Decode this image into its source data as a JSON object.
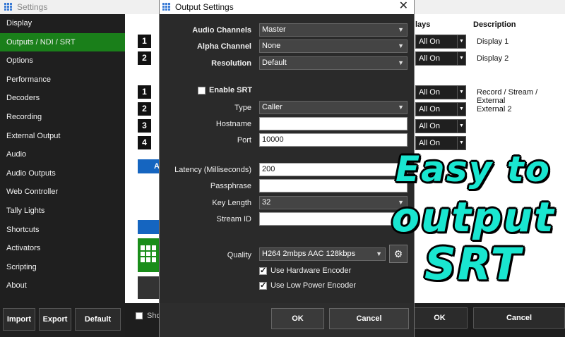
{
  "background_window": {
    "title": "Settings",
    "sidebar": [
      {
        "label": "Display",
        "active": false
      },
      {
        "label": "Outputs / NDI / SRT",
        "active": true
      },
      {
        "label": "Options",
        "active": false
      },
      {
        "label": "Performance",
        "active": false
      },
      {
        "label": "Decoders",
        "active": false
      },
      {
        "label": "Recording",
        "active": false
      },
      {
        "label": "External Output",
        "active": false
      },
      {
        "label": "Audio",
        "active": false
      },
      {
        "label": "Audio Outputs",
        "active": false
      },
      {
        "label": "Web Controller",
        "active": false
      },
      {
        "label": "Tally Lights",
        "active": false
      },
      {
        "label": "Shortcuts",
        "active": false
      },
      {
        "label": "Activators",
        "active": false
      },
      {
        "label": "Scripting",
        "active": false
      },
      {
        "label": "About",
        "active": false
      }
    ],
    "sidebar_buttons": {
      "import": "Import",
      "export": "Export",
      "default": "Default"
    },
    "column_headers": {
      "overlays": "lays",
      "description": "Description"
    },
    "display_rows": [
      {
        "number": "1",
        "overlay": "All On",
        "description": "Display 1"
      },
      {
        "number": "2",
        "overlay": "All On",
        "description": "Display 2"
      }
    ],
    "output_rows": [
      {
        "number": "1",
        "overlay": "All On",
        "description": "Record / Stream / External"
      },
      {
        "number": "2",
        "overlay": "All On",
        "description": "External 2"
      },
      {
        "number": "3",
        "overlay": "All On",
        "description": ""
      },
      {
        "number": "4",
        "overlay": "All On",
        "description": ""
      }
    ],
    "partial_button_label": "A",
    "show_checkbox_label": "Sho",
    "ok_label": "OK",
    "cancel_label": "Cancel"
  },
  "dialog": {
    "title": "Output Settings",
    "close_glyph": "✕",
    "audio_channels": {
      "label": "Audio Channels",
      "value": "Master"
    },
    "alpha_channel": {
      "label": "Alpha Channel",
      "value": "None"
    },
    "resolution": {
      "label": "Resolution",
      "value": "Default"
    },
    "enable_srt": {
      "label": "Enable SRT",
      "checked": false
    },
    "type": {
      "label": "Type",
      "value": "Caller"
    },
    "hostname": {
      "label": "Hostname",
      "value": ""
    },
    "port": {
      "label": "Port",
      "value": "10000"
    },
    "latency": {
      "label": "Latency (Milliseconds)",
      "value": "200"
    },
    "passphrase": {
      "label": "Passphrase",
      "value": ""
    },
    "key_length": {
      "label": "Key Length",
      "value": "32"
    },
    "stream_id": {
      "label": "Stream ID",
      "value": ""
    },
    "quality": {
      "label": "Quality",
      "value": "H264 2mbps AAC 128kbps"
    },
    "use_hardware_encoder": {
      "label": "Use Hardware Encoder",
      "checked": true
    },
    "use_low_power_encoder": {
      "label": "Use Low Power Encoder",
      "checked": true
    },
    "ok_label": "OK",
    "cancel_label": "Cancel"
  },
  "overlay_text": {
    "line1": "Easy to",
    "line2": "output",
    "line3": "SRT"
  },
  "colors": {
    "accent_green": "#1a7f1a",
    "overlay_cyan": "#19e6d0",
    "blue_button": "#1565c0"
  }
}
